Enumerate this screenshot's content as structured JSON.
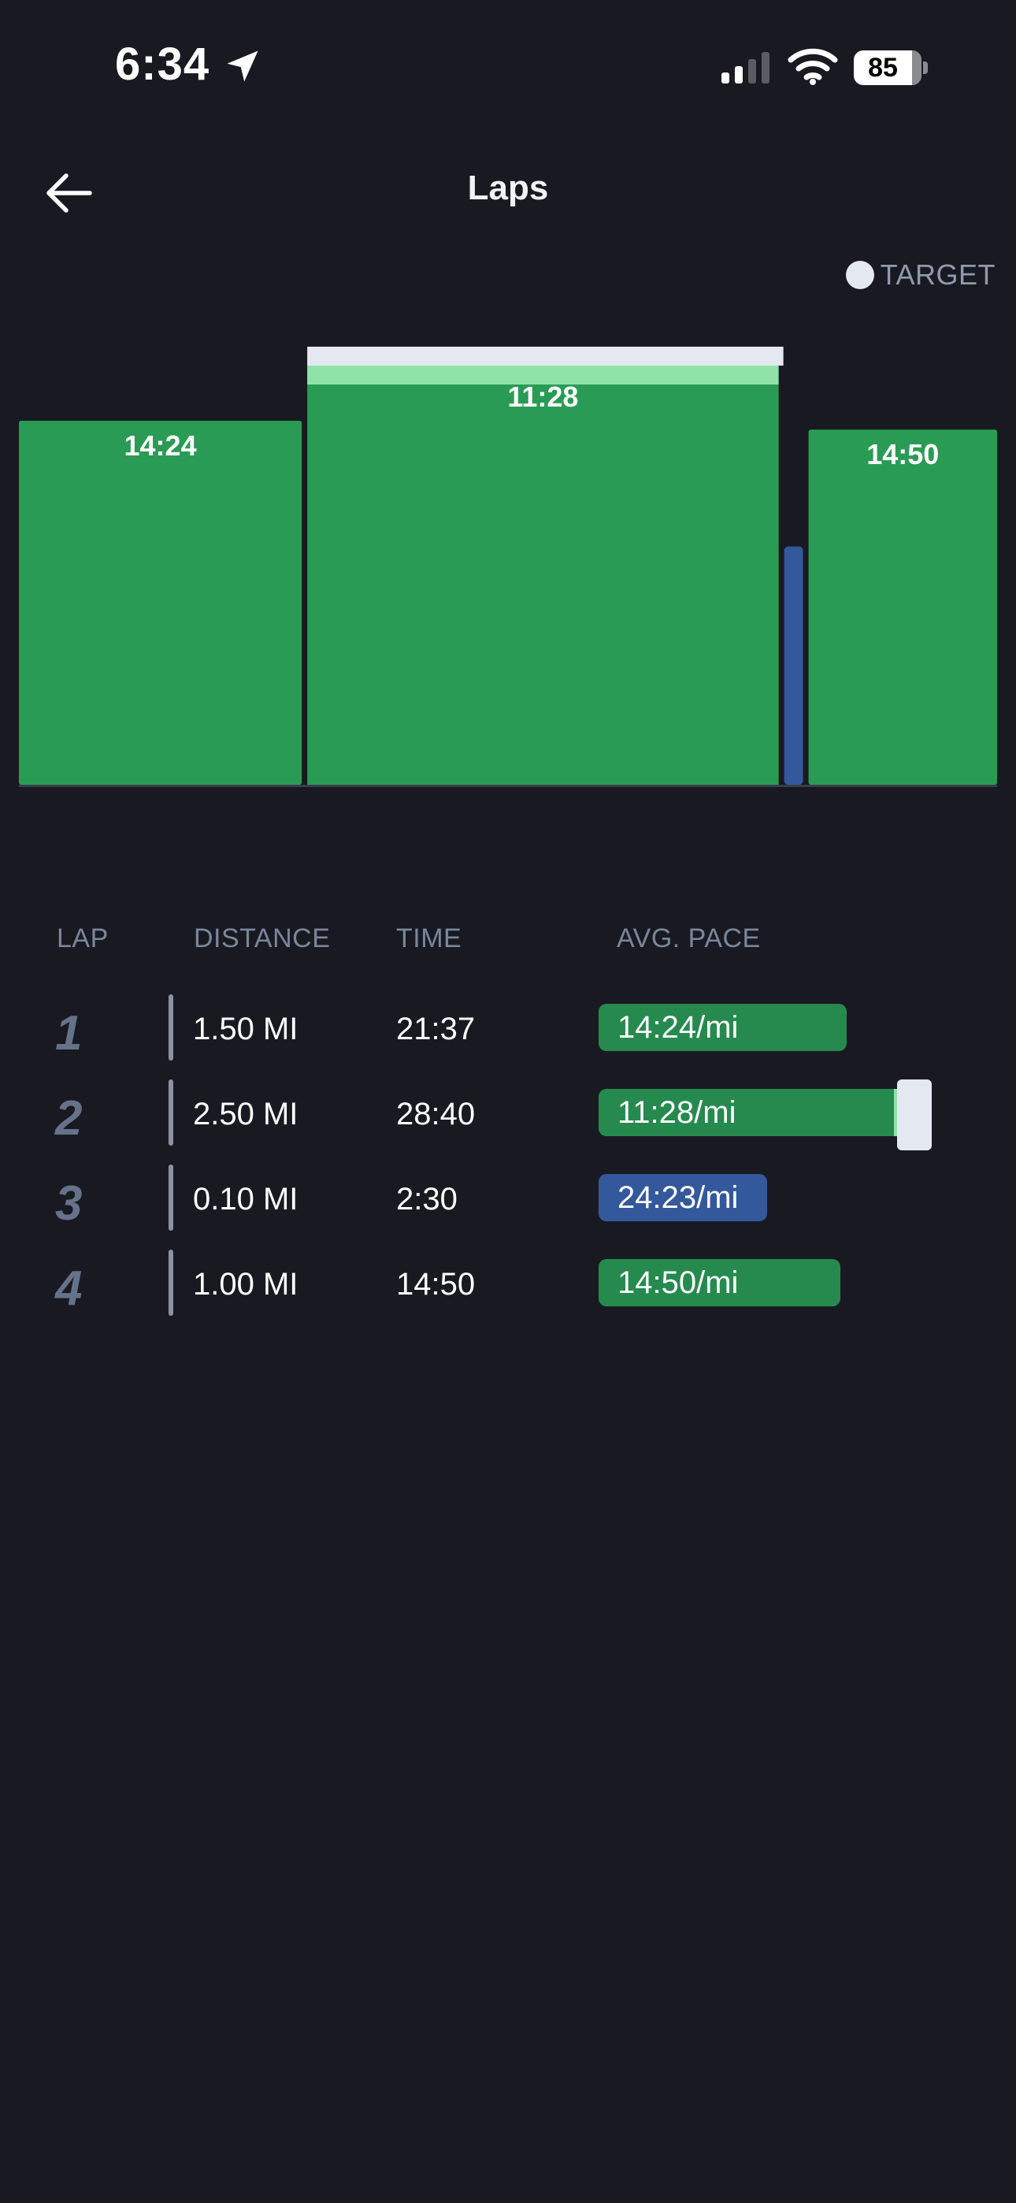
{
  "status_bar": {
    "time": "6:34",
    "battery": "85"
  },
  "header": {
    "title": "Laps"
  },
  "legend": {
    "target_label": "TARGET"
  },
  "colors": {
    "pace_green": "#2a9b55",
    "pace_green_dark": "#268a4f",
    "target_band": "#e4e8f0",
    "target_highlight": "#8fe3a8",
    "slow_lap_blue": "#34589c",
    "background": "#191a21"
  },
  "table": {
    "headers": {
      "lap": "LAP",
      "distance": "DISTANCE",
      "time": "TIME",
      "pace": "AVG. PACE"
    },
    "rows": [
      {
        "lap": "1",
        "distance": "1.50 MI",
        "time": "21:37",
        "pace": "14:24/mi",
        "pace_fraction": 0.75,
        "status": "green"
      },
      {
        "lap": "2",
        "distance": "2.50 MI",
        "time": "28:40",
        "pace": "11:28/mi",
        "pace_fraction": 0.95,
        "status": "green",
        "target": true
      },
      {
        "lap": "3",
        "distance": "0.10 MI",
        "time": "2:30",
        "pace": "24:23/mi",
        "pace_fraction": 0.51,
        "status": "blue"
      },
      {
        "lap": "4",
        "distance": "1.00 MI",
        "time": "14:50",
        "pace": "14:50/mi",
        "pace_fraction": 0.73,
        "status": "green"
      }
    ]
  },
  "chart_data": {
    "type": "bar",
    "categories": [
      "1",
      "2",
      "3",
      "4"
    ],
    "widths_mi": [
      1.5,
      2.5,
      0.1,
      1.0
    ],
    "labels": [
      "14:24",
      "11:28",
      "",
      "14:50"
    ],
    "values": [
      0.825,
      0.955,
      0.54,
      0.805
    ],
    "colors": [
      "green",
      "green",
      "blue",
      "green"
    ],
    "target": {
      "lap": "2",
      "level": 1.0
    }
  }
}
